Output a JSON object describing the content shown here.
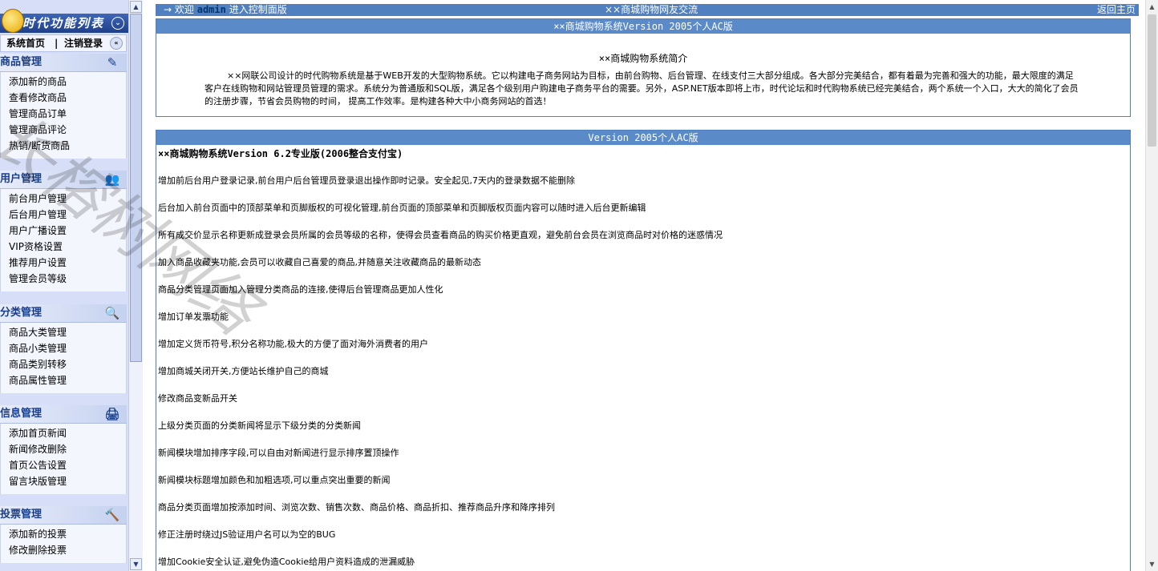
{
  "sidebar": {
    "logo_text": "时代功能列表",
    "nav_home": "系统首页",
    "nav_sep": "|",
    "nav_logout": "注销登录",
    "sections": [
      {
        "title": "商品管理",
        "icon": "edit-icon",
        "items": [
          "添加新的商品",
          "查看修改商品",
          "管理商品订单",
          "管理商品评论",
          "热销/断货商品"
        ]
      },
      {
        "title": "用户管理",
        "icon": "users-icon",
        "items": [
          "前台用户管理",
          "后台用户管理",
          "用户广播设置",
          "VIP资格设置",
          "推荐用户设置",
          "管理会员等级"
        ]
      },
      {
        "title": "分类管理",
        "icon": "search-icon",
        "items": [
          "商品大类管理",
          "商品小类管理",
          "商品类别转移",
          "商品属性管理"
        ]
      },
      {
        "title": "信息管理",
        "icon": "printer-icon",
        "items": [
          "添加首页新闻",
          "新闻修改删除",
          "首页公告设置",
          "留言块版管理"
        ]
      },
      {
        "title": "投票管理",
        "icon": "hammer-icon",
        "items": [
          "添加新的投票",
          "修改删除投票"
        ]
      }
    ]
  },
  "topbar": {
    "arrow": "→",
    "welcome_prefix": "欢迎",
    "username": "admin",
    "welcome_suffix": "进入控制面版",
    "center": "××商城购物网友交流",
    "home_link": "返回主页"
  },
  "intro_panel": {
    "header": "××商城购物系统Version 2005个人AC版",
    "title": "××商城购物系统简介",
    "text": "××网联公司设计的时代购物系统是基于WEB开发的大型购物系统。它以构建电子商务网站为目标，由前台购物、后台管理、在线支付三大部分组成。各大部分完美结合，都有着最为完善和强大的功能，最大限度的满足客户在线购物和网站管理员管理的需求。系统分为普通版和SQL版，满足各个级别用户购建电子商务平台的需要。另外，ASP.NET版本即将上市，时代论坛和时代购物系统已经完美结合，两个系统一个入口，大大的简化了会员的注册步骤，节省会员购物的时间， 提高工作效率。是构建各种大中小商务网站的首选！"
  },
  "log_panel": {
    "header": "Version 2005个人AC版",
    "first": "××商城购物系统Version 6.2专业版(2006整合支付宝)",
    "items": [
      "增加前后台用户登录记录,前台用户后台管理员登录退出操作即时记录。安全起见,7天内的登录数据不能删除",
      "后台加入前台页面中的顶部菜单和页脚版权的可视化管理,前台页面的顶部菜单和页脚版权页面内容可以随时进入后台更新编辑",
      "所有成交价显示名称更新成登录会员所属的会员等级的名称，使得会员查看商品的购买价格更直观，避免前台会员在浏览商品时对价格的迷惑情况",
      "加入商品收藏夹功能,会员可以收藏自己喜爱的商品,并随意关注收藏商品的最新动态",
      "商品分类管理页面加入管理分类商品的连接,使得后台管理商品更加人性化",
      "增加订单发票功能",
      "增加定义货币符号,积分名称功能,极大的方便了面对海外消费者的用户",
      "增加商城关闭开关,方便站长维护自己的商城",
      "修改商品变新品开关",
      "上级分类页面的分类新闻将显示下级分类的分类新闻",
      "新闻模块增加排序字段,可以自由对新闻进行显示排序置顶操作",
      "新闻模块标题增加颜色和加粗选项,可以重点突出重要的新闻",
      "商品分类页面增加按添加时间、浏览次数、销售次数、商品价格、商品折扣、推荐商品升序和降序排列",
      "修正注册时绕过JS验证用户名可以为空的BUG",
      "增加Cookie安全认证,避免伪造Cookie给用户资料造成的泄漏威胁"
    ]
  },
  "watermark": "长榕树网络"
}
